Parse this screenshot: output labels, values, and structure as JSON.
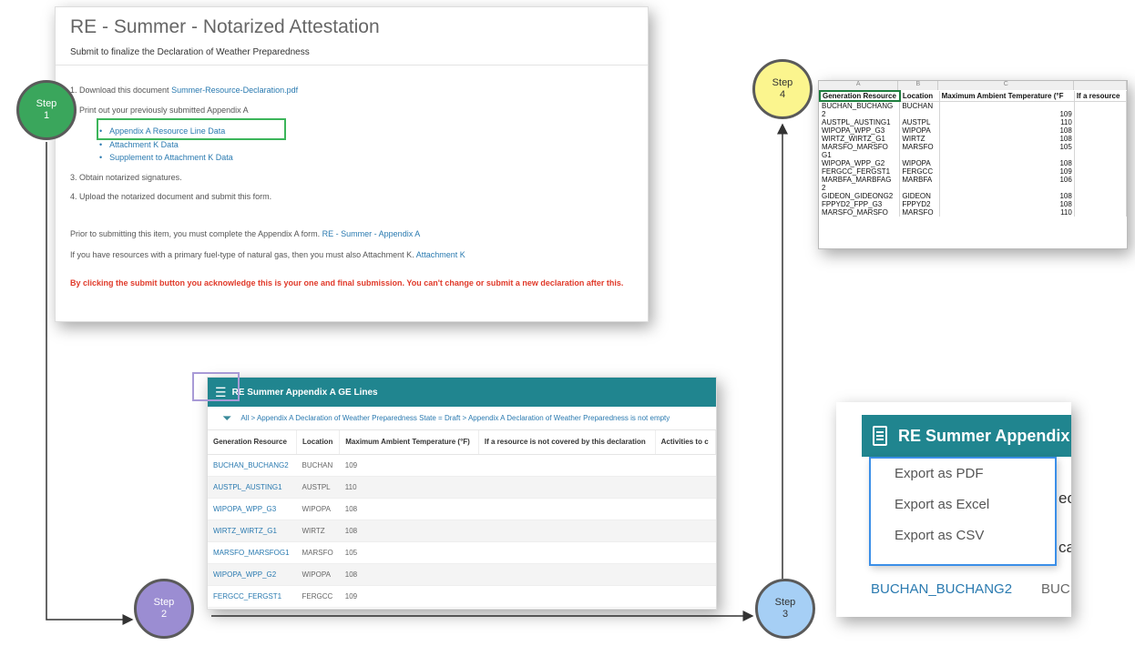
{
  "attestation": {
    "title": "RE - Summer - Notarized Attestation",
    "subtitle": "Submit to finalize the Declaration of Weather Preparedness",
    "step1_prefix": "1. Download this document",
    "step1_link": "Summer-Resource-Declaration.pdf",
    "step2_text": "2. Print out your previously submitted Appendix A",
    "bullets": [
      "Appendix A Resource Line Data",
      "Attachment K Data",
      "Supplement to Attachment K Data"
    ],
    "step3_text": "3. Obtain notarized signatures.",
    "step4_text": "4. Upload the notarized document and submit this form.",
    "prior_text": "Prior to submitting this item, you must complete the Appendix A form.",
    "prior_link": "RE - Summer - Appendix A",
    "gas_text": "If you have resources with a primary fuel-type of natural gas, then you must also Attachment K.",
    "gas_link": "Attachment K",
    "warning": "By clicking the submit button you acknowledge this is your one and final submission. You can't change or submit a new declaration after this."
  },
  "excel": {
    "col_letters": [
      "A",
      "B",
      "C",
      ""
    ],
    "headers": [
      "Generation Resource",
      "Location",
      "Maximum Ambient Temperature (°F",
      "If a resource"
    ],
    "rows": [
      [
        "BUCHAN_BUCHANG",
        "BUCHAN",
        ""
      ],
      [
        "2",
        "",
        "109"
      ],
      [
        "AUSTPL_AUSTING1",
        "AUSTPL",
        "110"
      ],
      [
        "WIPOPA_WPP_G3",
        "WIPOPA",
        "108"
      ],
      [
        "WIRTZ_WIRTZ_G1",
        "WIRTZ",
        "108"
      ],
      [
        "MARSFO_MARSFO",
        "MARSFO",
        "105"
      ],
      [
        "G1",
        "",
        ""
      ],
      [
        "WIPOPA_WPP_G2",
        "WIPOPA",
        "108"
      ],
      [
        "FERGCC_FERGST1",
        "FERGCC",
        "109"
      ],
      [
        "MARBFA_MARBFAG",
        "MARBFA",
        "106"
      ],
      [
        "2",
        "",
        ""
      ],
      [
        "GIDEON_GIDEONG2",
        "GIDEON",
        "108"
      ],
      [
        "FPPYD2_FPP_G3",
        "FPPYD2",
        "108"
      ],
      [
        "MARSFO_MARSFO",
        "MARSFO",
        "110"
      ]
    ]
  },
  "ge_lines": {
    "title": "RE Summer Appendix A GE Lines",
    "filter": "All > Appendix A Declaration of Weather Preparedness State = Draft > Appendix A Declaration of Weather Preparedness is not empty",
    "headers": [
      "Generation Resource",
      "Location",
      "Maximum Ambient Temperature (°F)",
      "If a resource is not covered by this declaration",
      "Activities to c"
    ],
    "rows": [
      [
        "BUCHAN_BUCHANG2",
        "BUCHAN",
        "109"
      ],
      [
        "AUSTPL_AUSTING1",
        "AUSTPL",
        "110"
      ],
      [
        "WIPOPA_WPP_G3",
        "WIPOPA",
        "108"
      ],
      [
        "WIRTZ_WIRTZ_G1",
        "WIRTZ",
        "108"
      ],
      [
        "MARSFO_MARSFOG1",
        "MARSFO",
        "105"
      ],
      [
        "WIPOPA_WPP_G2",
        "WIPOPA",
        "108"
      ],
      [
        "FERGCC_FERGST1",
        "FERGCC",
        "109"
      ]
    ]
  },
  "export": {
    "title": "RE Summer Appendix",
    "options": [
      "Export as PDF",
      "Export as Excel",
      "Export as CSV"
    ],
    "ghost_1": "ecl",
    "ghost_2": "ca",
    "row_link": "BUCHAN_BUCHANG2",
    "row_loc": "BUC"
  },
  "steps": {
    "s1": [
      "Step",
      "1"
    ],
    "s2": [
      "Step",
      "2"
    ],
    "s3": [
      "Step",
      "3"
    ],
    "s4": [
      "Step",
      "4"
    ]
  },
  "colors": {
    "step1": "#3aa65c",
    "step2": "#9b8dd2",
    "step3": "#a6cff5",
    "step4": "#fbf58e",
    "teal_bar": "#20858f",
    "warning": "#e03a2a",
    "link": "#2a7ab0"
  }
}
